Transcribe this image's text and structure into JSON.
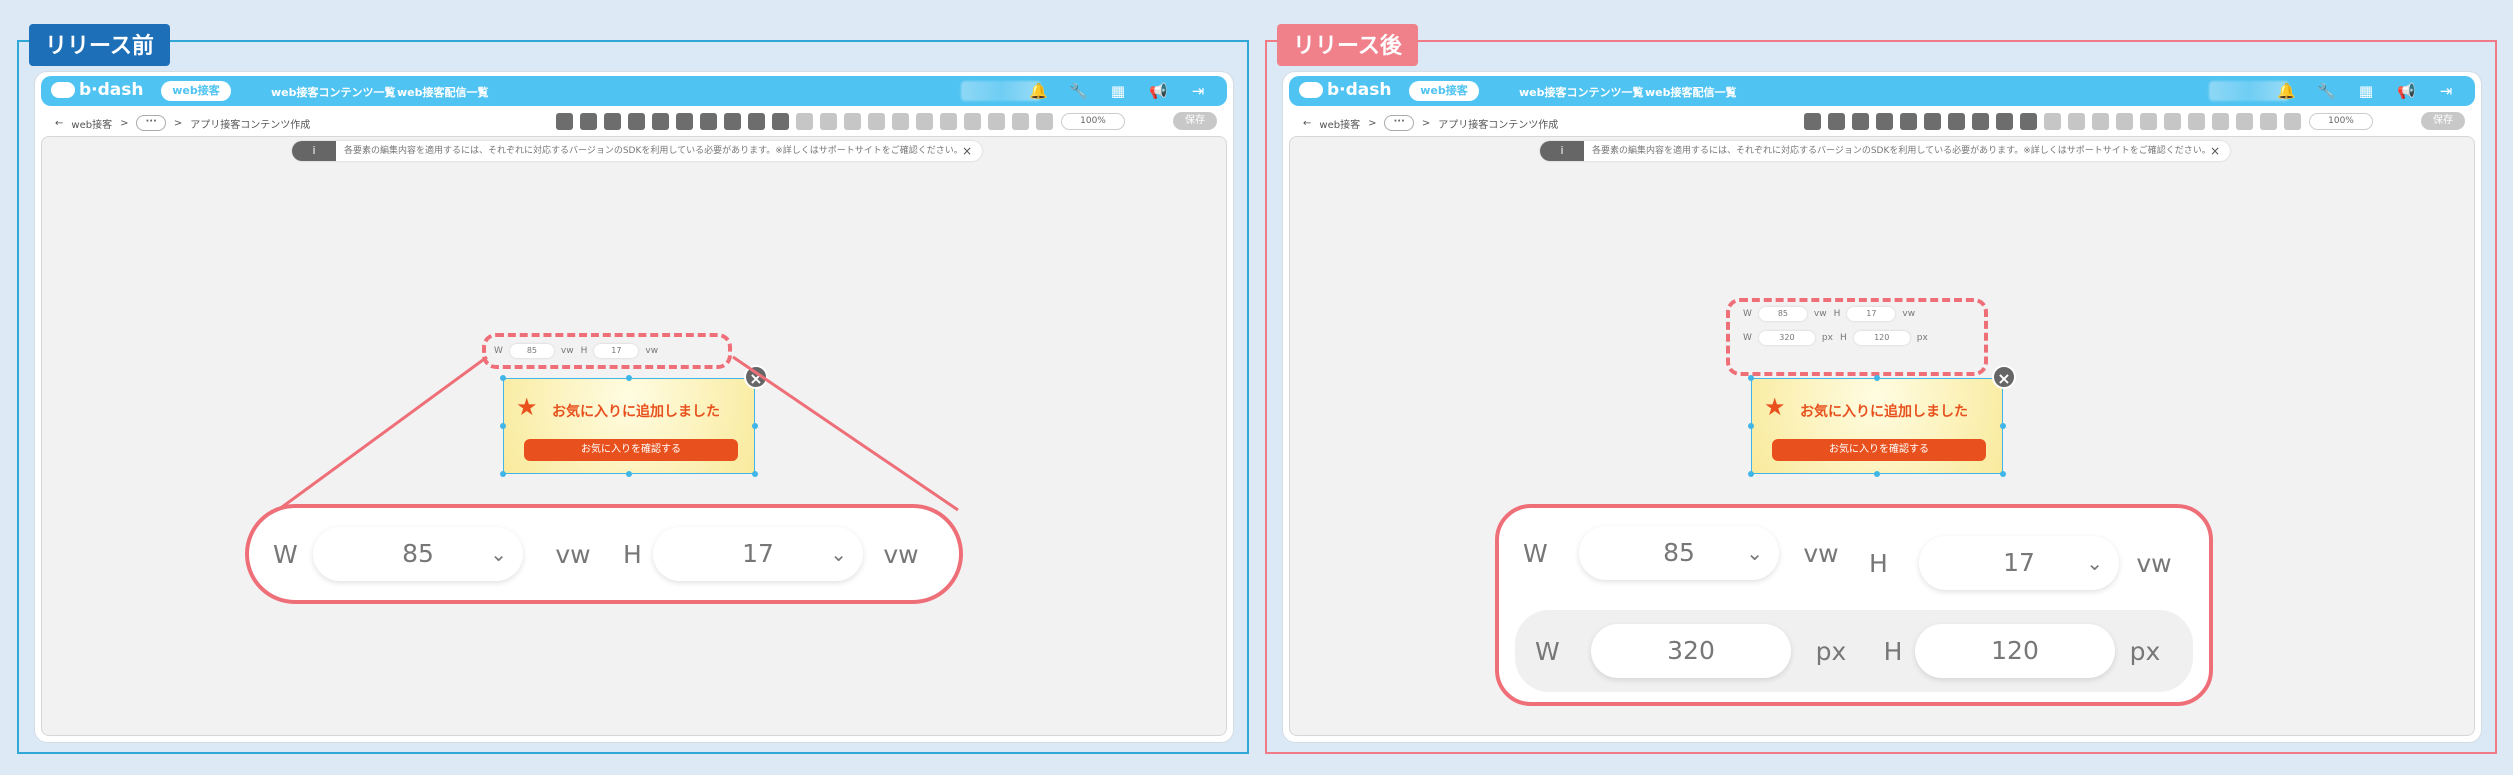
{
  "before": {
    "tag": "リリース前"
  },
  "after": {
    "tag": "リリース後"
  },
  "app": {
    "logo_text": "b·dash",
    "nav_active": "web接客",
    "nav_links": [
      "web接客コンテンツ一覧",
      "web接客配信一覧"
    ],
    "breadcrumb": {
      "back": "web接客",
      "separator": ">",
      "ellipsis": "···",
      "current": "アプリ接客コンテンツ作成"
    },
    "zoom_value": "100%",
    "save_label": "保存",
    "notice_text": "各要素の編集内容を適用するには、それぞれに対応するバージョンのSDKを利用している必要があります。※詳しくはサポートサイトをご確認ください。",
    "notice_icon": "i",
    "notice_close": "×",
    "top_icons": [
      "bell-icon",
      "wrench-icon",
      "grid-icon",
      "megaphone-icon",
      "logout-icon"
    ]
  },
  "banner": {
    "star": "★",
    "message": "お気に入りに追加しました",
    "button_label": "お気に入りを確認する",
    "close": "×"
  },
  "size_fields": {
    "w_label": "W",
    "h_label": "H",
    "w_value_vw": "85",
    "h_value_vw": "17",
    "unit_vw": "vw",
    "w_value_px": "320",
    "h_value_px": "120",
    "unit_px": "px",
    "chevron": "⌄"
  },
  "colors": {
    "accent_blue": "#4fc3f1",
    "before_tag": "#1d6fb8",
    "after_tag": "#f0818b",
    "highlight": "#ef6f79",
    "banner_orange": "#e8511d"
  }
}
